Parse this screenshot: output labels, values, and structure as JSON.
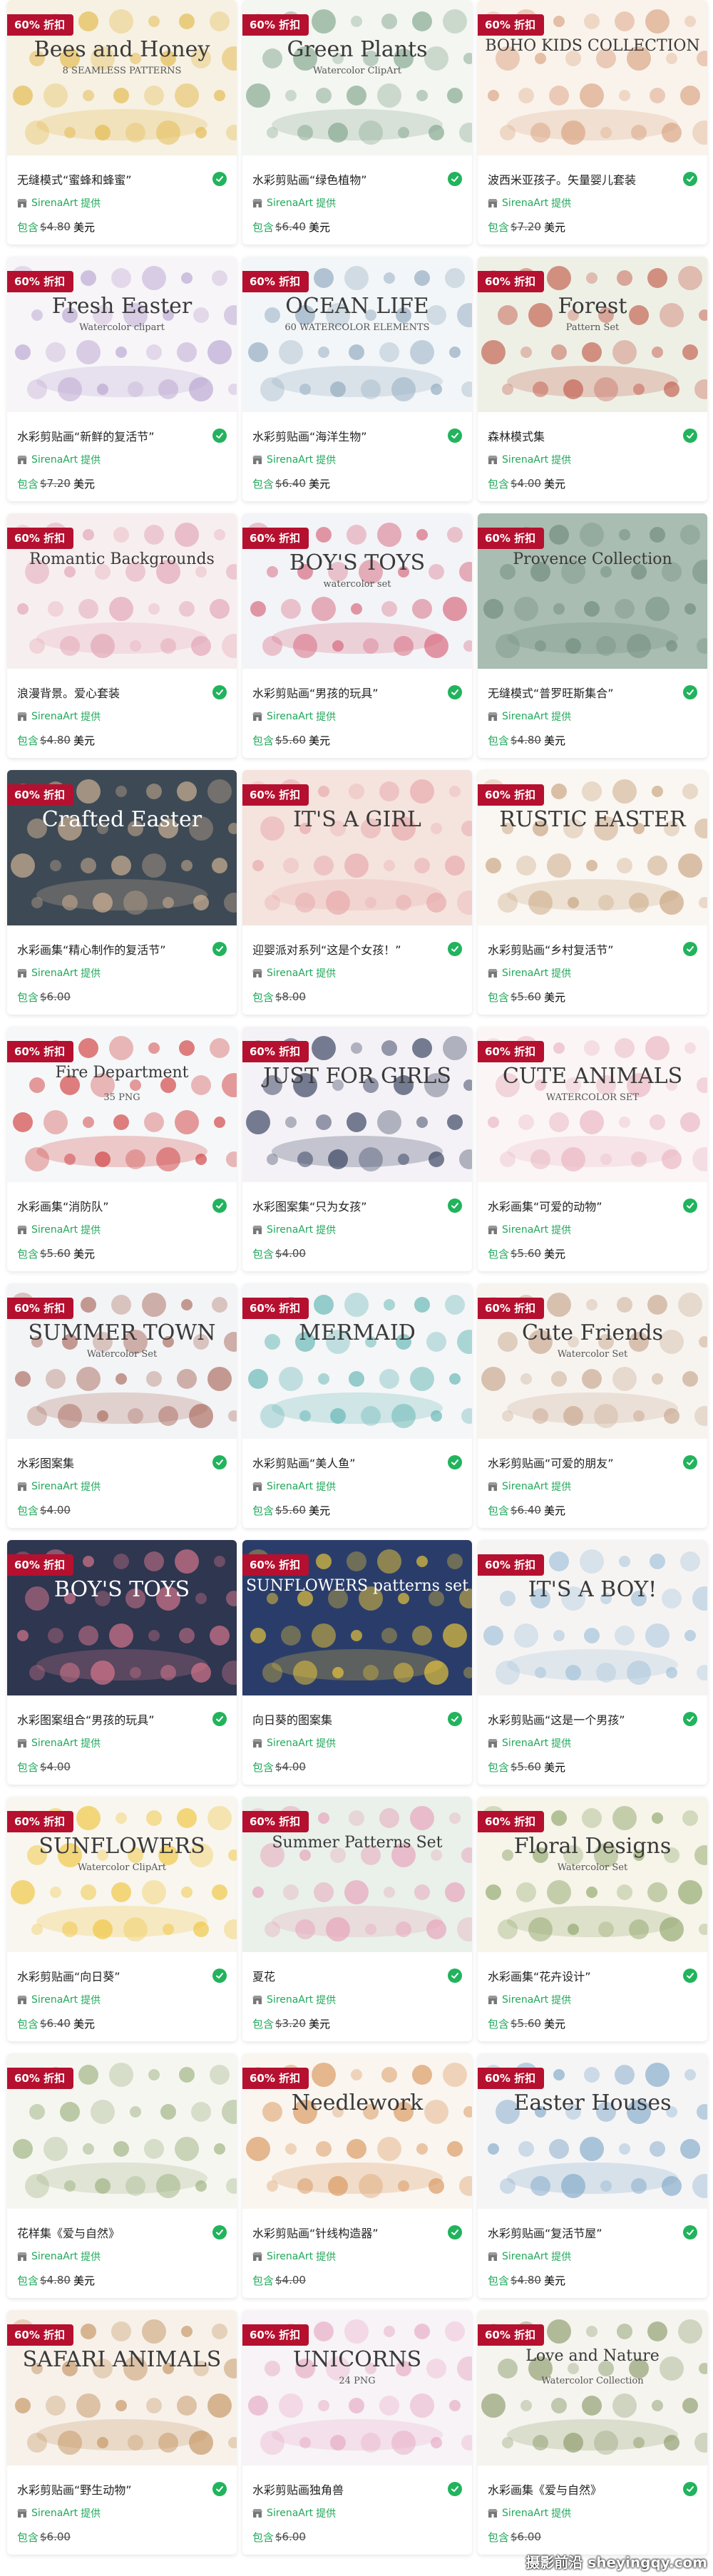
{
  "badge_text": "60% 折扣",
  "seller_name": "SirenaArt",
  "seller_suffix": "提供",
  "price_prefix": "包含",
  "watermark": "摄影前沿 sheyingqy.com",
  "cards": [
    {
      "title": "无缝模式“蜜蜂和蜂蜜”",
      "old_price": "4.80",
      "new_price": "美元",
      "thumb_text": "Bees and Honey",
      "thumb_sub": "8 SEAMLESS PATTERNS",
      "bg": "#f6f1e2",
      "accent": "#e3b84a"
    },
    {
      "title": "水彩剪贴画“绿色植物”",
      "old_price": "6.40",
      "new_price": "美元",
      "thumb_text": "Green Plants",
      "thumb_sub": "Watercolor ClipArt",
      "bg": "#f4f6f2",
      "accent": "#7fa48a"
    },
    {
      "title": "波西米亚孩子。矢量婴儿套装",
      "old_price": "7.20",
      "new_price": "美元",
      "thumb_text": "BOHO KIDS COLLECTION",
      "thumb_sub": "",
      "bg": "#faf3ec",
      "accent": "#d9a27f"
    },
    {
      "title": "水彩剪贴画“新鲜的复活节”",
      "old_price": "7.20",
      "new_price": "美元",
      "thumb_text": "Fresh Easter",
      "thumb_sub": "Watercolor clipart",
      "bg": "#f7f5f8",
      "accent": "#b9a4d1"
    },
    {
      "title": "水彩剪贴画“海洋生物”",
      "old_price": "6.40",
      "new_price": "美元",
      "thumb_text": "OCEAN LIFE",
      "thumb_sub": "60 WATERCOLOR ELEMENTS",
      "bg": "#f3f6f8",
      "accent": "#8ea8bd"
    },
    {
      "title": "森林模式集",
      "old_price": "4.00",
      "new_price": "美元",
      "thumb_text": "Forest",
      "thumb_sub": "Pattern Set",
      "bg": "#eef0e6",
      "accent": "#c25a4a"
    },
    {
      "title": "浪漫背景。爱心套装",
      "old_price": "4.80",
      "new_price": "美元",
      "thumb_text": "Romantic Backgrounds",
      "thumb_sub": "",
      "bg": "#f7eef0",
      "accent": "#e2a3b3"
    },
    {
      "title": "水彩剪贴画“男孩的玩具”",
      "old_price": "5.60",
      "new_price": "美元",
      "thumb_text": "BOY'S TOYS",
      "thumb_sub": "watercolor set",
      "bg": "#f3f4f7",
      "accent": "#d6627a"
    },
    {
      "title": "无缝模式“普罗旺斯集合”",
      "old_price": "4.80",
      "new_price": "美元",
      "thumb_text": "Provence Collection",
      "thumb_sub": "",
      "bg": "#a9bdb2",
      "accent": "#6f8a7c"
    },
    {
      "title": "水彩画集“精心制作的复活节”",
      "old_price": "6.00",
      "new_price": "",
      "thumb_text": "Crafted Easter",
      "thumb_sub": "",
      "bg": "#3d4a55",
      "accent": "#d9b89a"
    },
    {
      "title": "迎婴派对系列“这是个女孩！”",
      "old_price": "8.00",
      "new_price": "",
      "thumb_text": "IT'S A GIRL",
      "thumb_sub": "",
      "bg": "#f5e3de",
      "accent": "#e6a6a8"
    },
    {
      "title": "水彩剪贴画“乡村复活节”",
      "old_price": "5.60",
      "new_price": "美元",
      "thumb_text": "RUSTIC EASTER",
      "thumb_sub": "",
      "bg": "#faf6f1",
      "accent": "#c8a27d"
    },
    {
      "title": "水彩画集“消防队”",
      "old_price": "5.60",
      "new_price": "美元",
      "thumb_text": "Fire Department",
      "thumb_sub": "35 PNG",
      "bg": "#f6f7f8",
      "accent": "#cf3c3c"
    },
    {
      "title": "水彩图案集“只为女孩”",
      "old_price": "4.00",
      "new_price": "",
      "thumb_text": "JUST FOR GIRLS",
      "thumb_sub": "",
      "bg": "#f4f2f6",
      "accent": "#2f3a5a"
    },
    {
      "title": "水彩画集“可爱的动物”",
      "old_price": "5.60",
      "new_price": "美元",
      "thumb_text": "CUTE ANIMALS",
      "thumb_sub": "WATERCOLOR SET",
      "bg": "#fbf5f6",
      "accent": "#e9b4c0"
    },
    {
      "title": "水彩图案集",
      "old_price": "4.00",
      "new_price": "",
      "thumb_text": "SUMMER TOWN",
      "thumb_sub": "Watercolor Set",
      "bg": "#f3f4f6",
      "accent": "#a9675a"
    },
    {
      "title": "水彩剪贴画“美人鱼”",
      "old_price": "5.60",
      "new_price": "美元",
      "thumb_text": "MERMAID",
      "thumb_sub": "",
      "bg": "#f5f6f7",
      "accent": "#5fb3b3"
    },
    {
      "title": "水彩剪贴画“可爱的朋友”",
      "old_price": "6.40",
      "new_price": "美元",
      "thumb_text": "Cute Friends",
      "thumb_sub": "Watercolor Set",
      "bg": "#f7f4f0",
      "accent": "#c7a58c"
    },
    {
      "title": "水彩图案组合“男孩的玩具”",
      "old_price": "4.00",
      "new_price": "",
      "thumb_text": "BOY'S TOYS",
      "thumb_sub": "",
      "bg": "#2e3650",
      "accent": "#e07b8f"
    },
    {
      "title": "向日葵的图案集",
      "old_price": "4.00",
      "new_price": "",
      "thumb_text": "SUNFLOWERS patterns set",
      "thumb_sub": "",
      "bg": "#2a3d6a",
      "accent": "#f2cc3a"
    },
    {
      "title": "水彩剪贴画“这是一个男孩”",
      "old_price": "5.60",
      "new_price": "美元",
      "thumb_text": "IT'S A BOY!",
      "thumb_sub": "",
      "bg": "#f6f4f3",
      "accent": "#9ec0d9"
    },
    {
      "title": "水彩剪贴画“向日葵”",
      "old_price": "6.40",
      "new_price": "美元",
      "thumb_text": "SUNFLOWERS",
      "thumb_sub": "Watercolor ClipArt",
      "bg": "#f8f6ef",
      "accent": "#f0c43a"
    },
    {
      "title": "夏花",
      "old_price": "3.20",
      "new_price": "美元",
      "thumb_text": "Summer Patterns Set",
      "thumb_sub": "",
      "bg": "#e9f1ea",
      "accent": "#e8a0b8"
    },
    {
      "title": "水彩画集“花卉设计”",
      "old_price": "5.60",
      "new_price": "美元",
      "thumb_text": "Floral Designs",
      "thumb_sub": "Watercolor Set",
      "bg": "#f7f4ea",
      "accent": "#8fa66a"
    },
    {
      "title": "花样集《爱与自然》",
      "old_price": "4.80",
      "new_price": "美元",
      "thumb_text": "",
      "thumb_sub": "",
      "bg": "#f6f6f1",
      "accent": "#9bb07e"
    },
    {
      "title": "水彩剪贴画“针线构造器”",
      "old_price": "4.00",
      "new_price": "",
      "thumb_text": "Needlework",
      "thumb_sub": "",
      "bg": "#faf5ef",
      "accent": "#d8955a"
    },
    {
      "title": "水彩剪贴画“复活节屋”",
      "old_price": "4.80",
      "new_price": "美元",
      "thumb_text": "Easter Houses",
      "thumb_sub": "",
      "bg": "#f5f5f6",
      "accent": "#7fa8c9"
    },
    {
      "title": "水彩剪贴画“野生动物”",
      "old_price": "6.00",
      "new_price": "",
      "thumb_text": "SAFARI ANIMALS",
      "thumb_sub": "",
      "bg": "#f7f1ea",
      "accent": "#c4935f"
    },
    {
      "title": "水彩剪贴画独角兽",
      "old_price": "6.00",
      "new_price": "",
      "thumb_text": "UNICORNS",
      "thumb_sub": "24 PNG",
      "bg": "#f7f3f7",
      "accent": "#e7a9c3"
    },
    {
      "title": "水彩画集《爱与自然》",
      "old_price": "6.00",
      "new_price": "",
      "thumb_text": "Love and Nature",
      "thumb_sub": "Watercolor Collection",
      "bg": "#f6f4ee",
      "accent": "#8a9b6c"
    }
  ]
}
